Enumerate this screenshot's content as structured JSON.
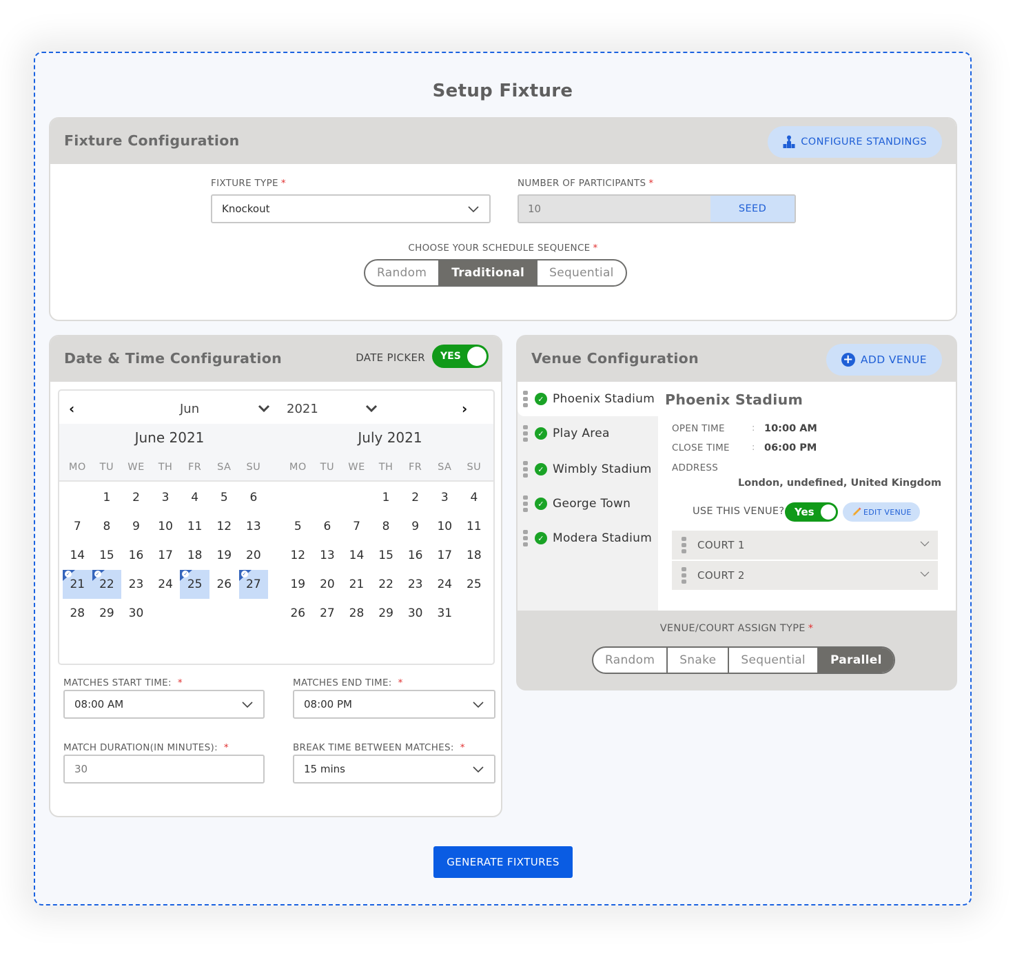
{
  "page": {
    "title": "Setup Fixture",
    "accent_color": "#0a5ce3",
    "frame_border_color": "#1a62e0"
  },
  "fixture_config": {
    "title": "Fixture Configuration",
    "configure_standings_label": "CONFIGURE STANDINGS",
    "configure_standings_icon": "podium-icon",
    "fixture_type": {
      "label": "FIXTURE TYPE",
      "required": "*",
      "value": "Knockout"
    },
    "participants": {
      "label": "NUMBER OF PARTICIPANTS",
      "required": "*",
      "value": "10",
      "seed_label": "SEED"
    },
    "schedule_sequence": {
      "label": "CHOOSE YOUR SCHEDULE SEQUENCE",
      "required": "*",
      "options": [
        "Random",
        "Traditional",
        "Sequential"
      ],
      "selected": "Traditional"
    }
  },
  "date_time_config": {
    "title": "Date & Time Configuration",
    "date_picker_label": "DATE PICKER",
    "date_picker_toggle": "YES",
    "date_picker_on": true,
    "calendar": {
      "month_select": "Jun",
      "year_select": "2021",
      "weekdays": [
        "MO",
        "TU",
        "WE",
        "TH",
        "FR",
        "SA",
        "SU"
      ],
      "months": [
        {
          "title": "June 2021",
          "leading_blanks": 1,
          "days": 30,
          "selected_days": [
            21,
            22,
            25,
            27
          ]
        },
        {
          "title": "July 2021",
          "leading_blanks": 3,
          "days": 31,
          "selected_days": []
        }
      ]
    },
    "start_time": {
      "label": "MATCHES START TIME:",
      "required": "*",
      "value": "08:00 AM"
    },
    "end_time": {
      "label": "MATCHES END TIME:",
      "required": "*",
      "value": "08:00 PM"
    },
    "match_duration": {
      "label": "MATCH DURATION(IN MINUTES):",
      "required": "*",
      "value": "30"
    },
    "break_time": {
      "label": "BREAK TIME BETWEEN MATCHES:",
      "required": "*",
      "value": "15 mins"
    }
  },
  "venue_config": {
    "title": "Venue Configuration",
    "add_venue_label": "ADD VENUE",
    "venues": [
      {
        "name": "Phoenix Stadium",
        "checked": true,
        "active": true
      },
      {
        "name": "Play Area",
        "checked": true,
        "active": false
      },
      {
        "name": "Wimbly Stadium",
        "checked": true,
        "active": false
      },
      {
        "name": "George Town",
        "checked": true,
        "active": false
      },
      {
        "name": "Modera Stadium",
        "checked": true,
        "active": false
      }
    ],
    "detail": {
      "name": "Phoenix Stadium",
      "open_time_label": "OPEN TIME",
      "open_time": "10:00 AM",
      "close_time_label": "CLOSE TIME",
      "close_time": "06:00 PM",
      "colon": ":",
      "address_label": "ADDRESS",
      "address": "London, undefined, United Kingdom",
      "use_venue_label": "USE THIS VENUE?",
      "use_venue_toggle": "Yes",
      "edit_venue_label": "EDIT VENUE",
      "courts": [
        "COURT 1",
        "COURT 2"
      ]
    },
    "assign_type": {
      "label": "VENUE/COURT ASSIGN TYPE",
      "required": "*",
      "options": [
        "Random",
        "Snake",
        "Sequential",
        "Parallel"
      ],
      "selected": "Parallel"
    }
  },
  "generate_button_label": "GENERATE FIXTURES"
}
